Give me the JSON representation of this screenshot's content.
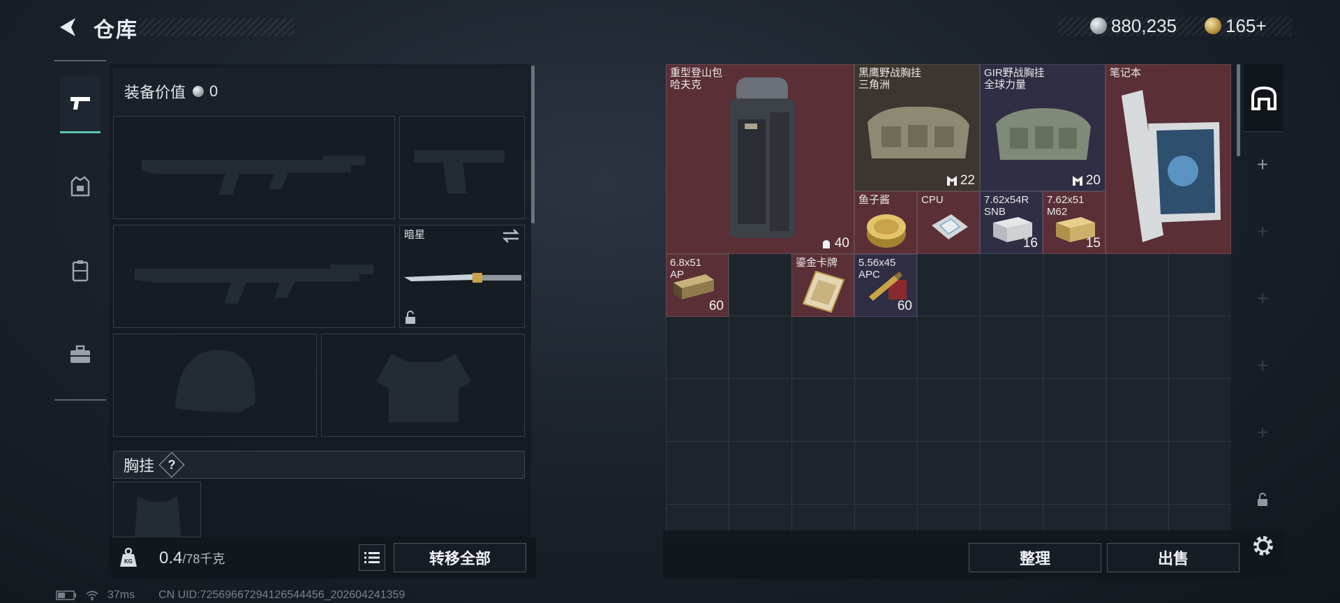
{
  "header": {
    "title": "仓库",
    "silver_amount": "880,235",
    "gold_amount": "165+"
  },
  "equipment": {
    "value_label": "装备价值",
    "value": "0",
    "melee_name": "暗星",
    "chest_rig_label": "胸挂",
    "chest_rig_help": "?"
  },
  "weight": {
    "current": "0.4",
    "max": "/78千克"
  },
  "buttons": {
    "transfer_all": "转移全部",
    "organize": "整理",
    "sell": "出售"
  },
  "stash_items": [
    {
      "name_line1": "重型登山包",
      "name_line2": "哈夫克",
      "count": "40",
      "count_icon": "backpack-capacity-icon"
    },
    {
      "name_line1": "黑鹰野战胸挂",
      "name_line2": "三角洲",
      "count": "22",
      "count_icon": "rig-capacity-icon"
    },
    {
      "name_line1": "GIR野战胸挂",
      "name_line2": "全球力量",
      "count": "20",
      "count_icon": "rig-capacity-icon"
    },
    {
      "name_line1": "笔记本",
      "name_line2": "",
      "count": ""
    },
    {
      "name_line1": "鱼子酱",
      "name_line2": "",
      "count": ""
    },
    {
      "name_line1": "CPU",
      "name_line2": "",
      "count": ""
    },
    {
      "name_line1": "7.62x54R",
      "name_line2": "SNB",
      "count": "16"
    },
    {
      "name_line1": "7.62x51",
      "name_line2": "M62",
      "count": "15"
    },
    {
      "name_line1": "6.8x51",
      "name_line2": "AP",
      "count": "60"
    },
    {
      "name_line1": "鎏金卡牌",
      "name_line2": "",
      "count": ""
    },
    {
      "name_line1": "5.56x45",
      "name_line2": "APC",
      "count": "60"
    }
  ],
  "status": {
    "ping": "37ms",
    "uid": "CN UID:72569667294126544456_202604241359"
  },
  "colors": {
    "accent_teal": "#58c8b0",
    "item_red": "#5a2f35",
    "item_purple": "#2f2e44",
    "item_grey": "#3d352f"
  }
}
